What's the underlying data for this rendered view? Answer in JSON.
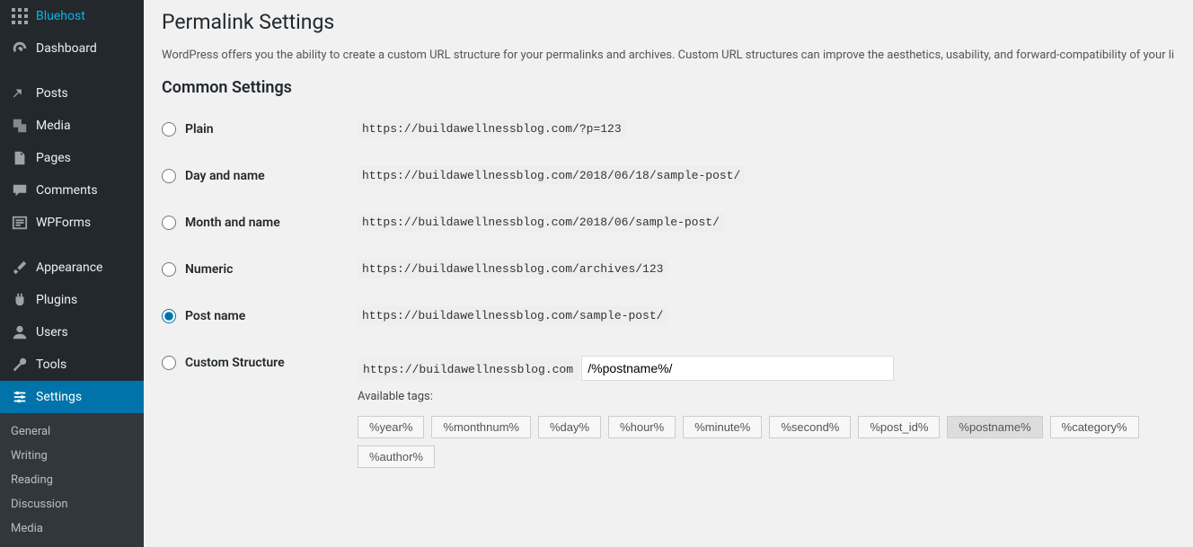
{
  "sidebar": {
    "items": [
      {
        "label": "Bluehost",
        "key": "bluehost"
      },
      {
        "label": "Dashboard",
        "key": "dashboard"
      },
      {
        "label": "Posts",
        "key": "posts"
      },
      {
        "label": "Media",
        "key": "media"
      },
      {
        "label": "Pages",
        "key": "pages"
      },
      {
        "label": "Comments",
        "key": "comments"
      },
      {
        "label": "WPForms",
        "key": "wpforms"
      },
      {
        "label": "Appearance",
        "key": "appearance"
      },
      {
        "label": "Plugins",
        "key": "plugins"
      },
      {
        "label": "Users",
        "key": "users"
      },
      {
        "label": "Tools",
        "key": "tools"
      },
      {
        "label": "Settings",
        "key": "settings"
      }
    ],
    "submenu": [
      "General",
      "Writing",
      "Reading",
      "Discussion",
      "Media"
    ]
  },
  "page": {
    "title": "Permalink Settings",
    "description": "WordPress offers you the ability to create a custom URL structure for your permalinks and archives. Custom URL structures can improve the aesthetics, usability, and forward-compatibility of your links. A",
    "section_heading": "Common Settings"
  },
  "options": [
    {
      "label": "Plain",
      "example": "https://buildawellnessblog.com/?p=123",
      "checked": false
    },
    {
      "label": "Day and name",
      "example": "https://buildawellnessblog.com/2018/06/18/sample-post/",
      "checked": false
    },
    {
      "label": "Month and name",
      "example": "https://buildawellnessblog.com/2018/06/sample-post/",
      "checked": false
    },
    {
      "label": "Numeric",
      "example": "https://buildawellnessblog.com/archives/123",
      "checked": false
    },
    {
      "label": "Post name",
      "example": "https://buildawellnessblog.com/sample-post/",
      "checked": true
    },
    {
      "label": "Custom Structure"
    }
  ],
  "custom": {
    "base": "https://buildawellnessblog.com",
    "value": "/%postname%/",
    "available_label": "Available tags:"
  },
  "tags": [
    {
      "label": "%year%",
      "active": false
    },
    {
      "label": "%monthnum%",
      "active": false
    },
    {
      "label": "%day%",
      "active": false
    },
    {
      "label": "%hour%",
      "active": false
    },
    {
      "label": "%minute%",
      "active": false
    },
    {
      "label": "%second%",
      "active": false
    },
    {
      "label": "%post_id%",
      "active": false
    },
    {
      "label": "%postname%",
      "active": true
    },
    {
      "label": "%category%",
      "active": false
    },
    {
      "label": "%author%",
      "active": false
    }
  ]
}
